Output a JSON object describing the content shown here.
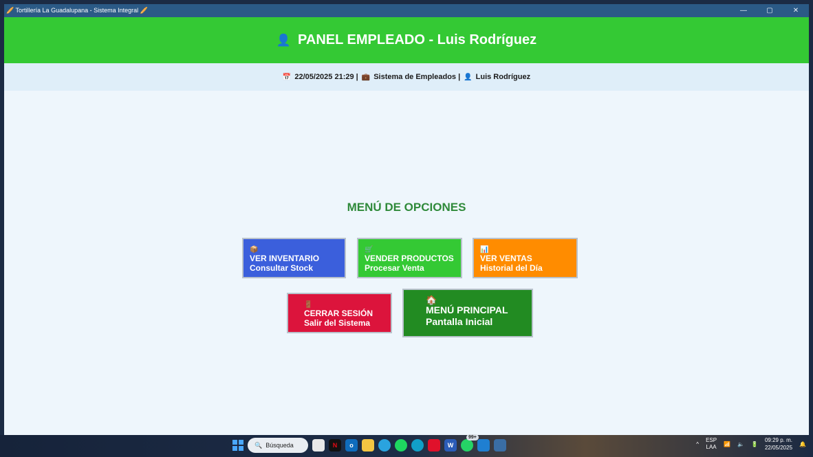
{
  "window": {
    "title": "🥖 Tortillería La Guadalupana - Sistema Integral 🥖",
    "controls": {
      "minimize": "—",
      "restore": "▢",
      "close": "✕"
    }
  },
  "header": {
    "icon": "👤",
    "title": "PANEL EMPLEADO - Luis Rodríguez"
  },
  "infobar": {
    "calendar_icon": "📅",
    "datetime": "22/05/2025 21:29 |",
    "system_icon": "💼",
    "system": "Sistema de Empleados |",
    "user_icon": "👤",
    "user": "Luis Rodríguez"
  },
  "menu": {
    "title": "MENÚ DE OPCIONES",
    "options": [
      {
        "icon": "📦",
        "label": "VER INVENTARIO",
        "sub": "Consultar Stock",
        "color": "#3b5fdc"
      },
      {
        "icon": "🛒",
        "label": "VENDER PRODUCTOS",
        "sub": "Procesar Venta",
        "color": "#34c934"
      },
      {
        "icon": "📊",
        "label": "VER VENTAS",
        "sub": "Historial del Día",
        "color": "#ff8c00"
      },
      {
        "icon": "🚪",
        "label": "CERRAR SESIÓN",
        "sub": "Salir del Sistema",
        "color": "#dc143c"
      },
      {
        "icon": "🏠",
        "label": "MENÚ PRINCIPAL",
        "sub": "Pantalla Inicial",
        "color": "#228b22"
      }
    ]
  },
  "taskbar": {
    "search_placeholder": "Búsqueda",
    "whatsapp_badge": "99+",
    "lang_top": "ESP",
    "lang_bottom": "LAA",
    "time": "09:29 p. m.",
    "date": "22/05/2025"
  }
}
